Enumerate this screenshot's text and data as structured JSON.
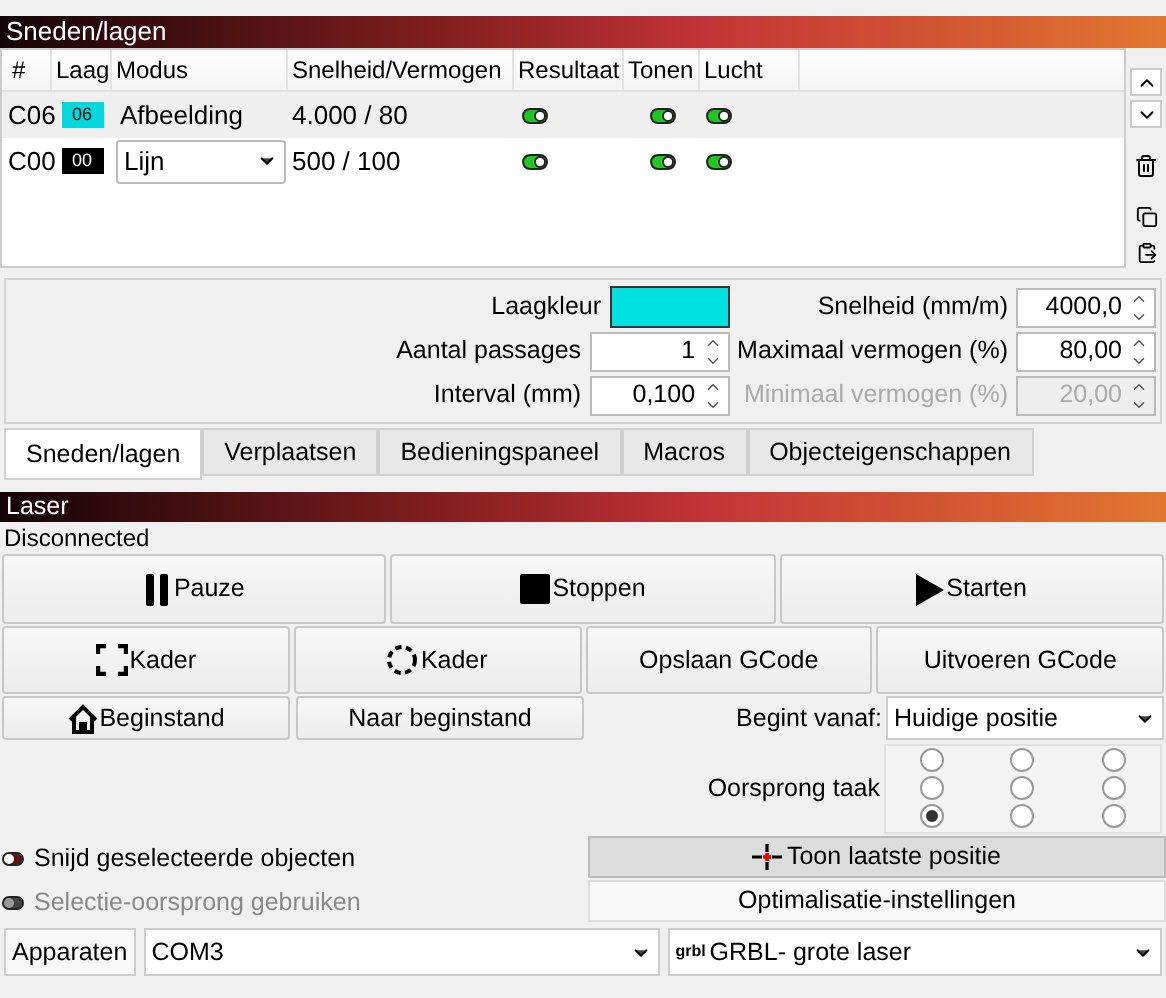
{
  "layers_panel": {
    "title": "Sneden/lagen",
    "columns": [
      "#",
      "Laag",
      "Modus",
      "Snelheid/Vermogen",
      "Resultaat",
      "Tonen",
      "Lucht"
    ],
    "rows": [
      {
        "id": "C06",
        "layer": "06",
        "color": "#00d8dc",
        "mode": "Afbeelding",
        "kind": "text",
        "speed_power": "4.000 / 80",
        "output": true,
        "show": true,
        "air": true,
        "selected": true
      },
      {
        "id": "C00",
        "layer": "00",
        "color": "#000000",
        "mode": "Lijn",
        "kind": "dropdown",
        "speed_power": "500 / 100",
        "output": true,
        "show": true,
        "air": true,
        "selected": false
      }
    ]
  },
  "settings": {
    "left": [
      {
        "kind": "color",
        "label": "Laagkleur",
        "color": "#00e0e0"
      },
      {
        "kind": "spin",
        "label": "Aantal passages",
        "value": "1",
        "disabled": false
      },
      {
        "kind": "spin",
        "label": "Interval (mm)",
        "value": "0,100",
        "disabled": false
      }
    ],
    "right": [
      {
        "kind": "spin",
        "label": "Snelheid (mm/m)",
        "value": "4000,0",
        "disabled": false
      },
      {
        "kind": "spin",
        "label": "Maximaal vermogen (%)",
        "value": "80,00",
        "disabled": false
      },
      {
        "kind": "spin",
        "label": "Minimaal vermogen (%)",
        "value": "20,00",
        "disabled": true
      }
    ]
  },
  "tabs": [
    {
      "label": "Sneden/lagen",
      "selected": true
    },
    {
      "label": "Verplaatsen",
      "selected": false
    },
    {
      "label": "Bedieningspaneel",
      "selected": false
    },
    {
      "label": "Macros",
      "selected": false
    },
    {
      "label": "Objecteigenschappen",
      "selected": false
    }
  ],
  "laser_panel": {
    "title": "Laser",
    "status": "Disconnected",
    "main_buttons": [
      {
        "kind": "pause",
        "label": "Pauze"
      },
      {
        "kind": "stop",
        "label": "Stoppen"
      },
      {
        "kind": "start",
        "label": "Starten"
      }
    ],
    "frame_buttons": [
      {
        "kind": "frame-square",
        "label": "Kader"
      },
      {
        "kind": "frame-circle",
        "label": "Kader"
      },
      {
        "kind": "plain",
        "label": "Opslaan GCode"
      },
      {
        "kind": "plain",
        "label": "Uitvoeren GCode"
      }
    ],
    "home_buttons": [
      {
        "kind": "home",
        "label": "Beginstand"
      },
      {
        "kind": "plain",
        "label": "Naar beginstand"
      }
    ],
    "start_from": {
      "label": "Begint vanaf:",
      "value": "Huidige positie"
    },
    "job_origin": {
      "label": "Oorsprong taak",
      "options": [
        {
          "selected": false
        },
        {
          "selected": false
        },
        {
          "selected": false
        },
        {
          "selected": false
        },
        {
          "selected": false
        },
        {
          "selected": false
        },
        {
          "selected": true
        },
        {
          "selected": false
        },
        {
          "selected": false
        }
      ]
    },
    "toggles": [
      {
        "label": "Snijd geselecteerde objecten",
        "on": false,
        "disabled": false
      },
      {
        "label": "Selectie-oorsprong gebruiken",
        "on": false,
        "disabled": true
      }
    ],
    "show_last_position": {
      "label": "Toon laatste positie",
      "checked": true
    },
    "optimization_button": "Optimalisatie-instellingen",
    "devices_button": "Apparaten",
    "port": "COM3",
    "device": {
      "logo": "grbl",
      "name": "GRBL- grote laser"
    }
  }
}
